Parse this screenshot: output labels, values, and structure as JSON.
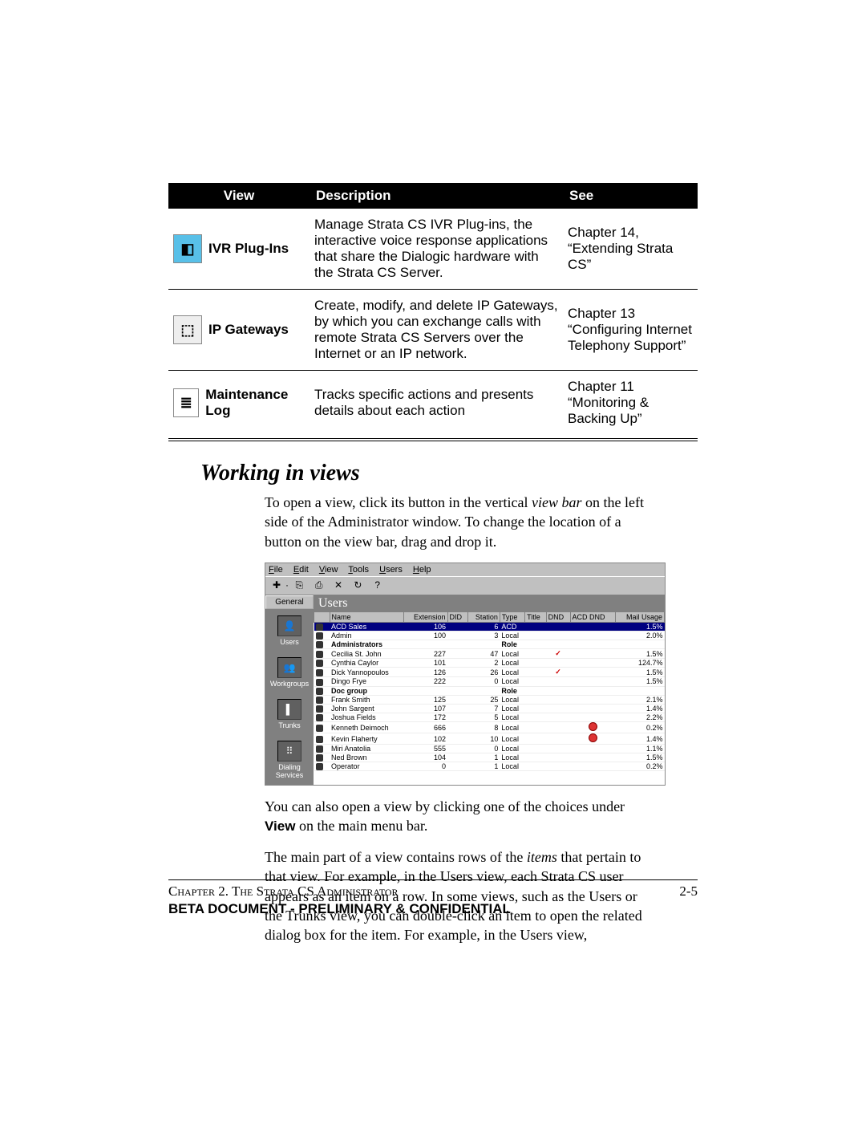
{
  "table": {
    "headers": [
      "View",
      "Description",
      "See"
    ],
    "rows": [
      {
        "view": "IVR Plug-Ins",
        "desc": "Manage Strata CS IVR Plug-ins, the interactive voice response applications that share the Dialogic hardware with the Strata CS Server.",
        "see": "Chapter 14, “Extending Strata CS”"
      },
      {
        "view": "IP Gateways",
        "desc": "Create, modify, and delete IP Gateways, by which you can exchange calls with remote Strata CS Servers over the Internet or an IP network.",
        "see": "Chapter 13 “Configuring Internet Telephony Support”"
      },
      {
        "view": "Maintenance Log",
        "desc": "Tracks specific actions and presents details about each action",
        "see": "Chapter 11 “Monitoring & Backing Up”"
      }
    ]
  },
  "section": {
    "title": "Working in views",
    "p1a": "To open a view, click its button in the vertical ",
    "p1_em": "view bar",
    "p1b": " on the left side of the Administrator window. To change the location of a button on the view bar, drag and drop it.",
    "p2a": "You can also open a view by clicking one of the choices under ",
    "p2_bold": "View",
    "p2b": " on the main menu bar.",
    "p3a": "The main part of a view contains rows of the ",
    "p3_em": "items",
    "p3b": " that pertain to that view. For example, in the Users view, each Strata CS user appears as an item on a row. In some views, such as the Users or the Trunks view, you can double-click an item to open the related dialog box for the item. For example, in the Users view,"
  },
  "shot": {
    "menus": [
      "File",
      "Edit",
      "View",
      "Tools",
      "Users",
      "Help"
    ],
    "side_tab": "General",
    "side": [
      "Users",
      "Workgroups",
      "Trunks",
      "Dialing Services"
    ],
    "title": "Users",
    "cols": [
      "",
      "Name",
      "Extension",
      "DID",
      "Station",
      "Type",
      "Title",
      "DND",
      "ACD DND",
      "Mail Usage"
    ],
    "rows": [
      {
        "sel": true,
        "bold": false,
        "name": "ACD Sales",
        "ext": "106",
        "did": "",
        "st": "6",
        "type": "ACD",
        "title": "",
        "dnd": "",
        "acd": "",
        "mail": "1.5%"
      },
      {
        "name": "Admin",
        "ext": "100",
        "did": "",
        "st": "3",
        "type": "Local",
        "title": "",
        "dnd": "",
        "acd": "",
        "mail": "2.0%"
      },
      {
        "bold": true,
        "name": "Administrators",
        "ext": "",
        "did": "",
        "st": "",
        "type": "Role",
        "title": "",
        "dnd": "",
        "acd": "",
        "mail": ""
      },
      {
        "name": "Cecilia St. John",
        "ext": "227",
        "did": "",
        "st": "47",
        "type": "Local",
        "title": "",
        "dnd": "chk",
        "acd": "",
        "mail": "1.5%"
      },
      {
        "name": "Cynthia Caylor",
        "ext": "101",
        "did": "",
        "st": "2",
        "type": "Local",
        "title": "",
        "dnd": "",
        "acd": "",
        "mail": "124.7%"
      },
      {
        "name": "Dick Yannopoulos",
        "ext": "126",
        "did": "",
        "st": "26",
        "type": "Local",
        "title": "",
        "dnd": "chk",
        "acd": "",
        "mail": "1.5%"
      },
      {
        "name": "Dingo Frye",
        "ext": "222",
        "did": "",
        "st": "0",
        "type": "Local",
        "title": "",
        "dnd": "",
        "acd": "",
        "mail": "1.5%"
      },
      {
        "bold": true,
        "name": "Doc group",
        "ext": "",
        "did": "",
        "st": "",
        "type": "Role",
        "title": "",
        "dnd": "",
        "acd": "",
        "mail": ""
      },
      {
        "name": "Frank Smith",
        "ext": "125",
        "did": "",
        "st": "25",
        "type": "Local",
        "title": "",
        "dnd": "",
        "acd": "",
        "mail": "2.1%"
      },
      {
        "name": "John Sargent",
        "ext": "107",
        "did": "",
        "st": "7",
        "type": "Local",
        "title": "",
        "dnd": "",
        "acd": "",
        "mail": "1.4%"
      },
      {
        "name": "Joshua Fields",
        "ext": "172",
        "did": "",
        "st": "5",
        "type": "Local",
        "title": "",
        "dnd": "",
        "acd": "",
        "mail": "2.2%"
      },
      {
        "name": "Kenneth Deimoch",
        "ext": "666",
        "did": "",
        "st": "8",
        "type": "Local",
        "title": "",
        "dnd": "",
        "acd": "dot",
        "mail": "0.2%"
      },
      {
        "name": "Kevin Flaherty",
        "ext": "102",
        "did": "",
        "st": "10",
        "type": "Local",
        "title": "",
        "dnd": "",
        "acd": "dot",
        "mail": "1.4%"
      },
      {
        "name": "Miri Anatolia",
        "ext": "555",
        "did": "",
        "st": "0",
        "type": "Local",
        "title": "",
        "dnd": "",
        "acd": "",
        "mail": "1.1%"
      },
      {
        "name": "Ned Brown",
        "ext": "104",
        "did": "",
        "st": "1",
        "type": "Local",
        "title": "",
        "dnd": "",
        "acd": "",
        "mail": "1.5%"
      },
      {
        "name": "Operator",
        "ext": "0",
        "did": "",
        "st": "1",
        "type": "Local",
        "title": "",
        "dnd": "",
        "acd": "",
        "mail": "0.2%"
      }
    ]
  },
  "footer": {
    "chapter": "Chapter 2.  The Strata CS Administrator",
    "page": "2-5",
    "conf": "BETA DOCUMENT - PRELIMINARY & CONFIDENTIAL"
  }
}
